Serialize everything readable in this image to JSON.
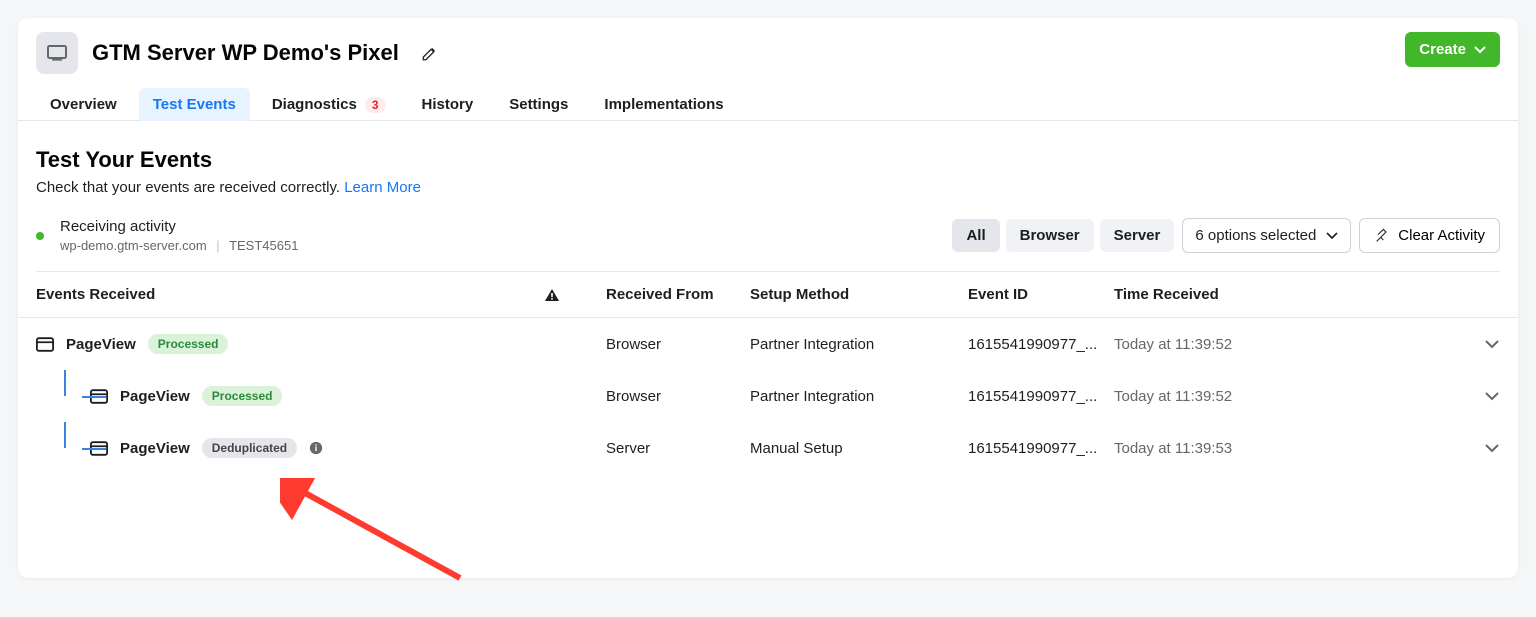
{
  "header": {
    "title": "GTM Server WP Demo's Pixel",
    "create_label": "Create"
  },
  "tabs": {
    "overview": "Overview",
    "test_events": "Test Events",
    "diagnostics": "Diagnostics",
    "diagnostics_count": "3",
    "history": "History",
    "settings": "Settings",
    "implementations": "Implementations"
  },
  "section": {
    "title": "Test Your Events",
    "subtitle": "Check that your events are received correctly. ",
    "learn_more": "Learn More"
  },
  "activity": {
    "label": "Receiving activity",
    "domain": "wp-demo.gtm-server.com",
    "test_id": "TEST45651"
  },
  "filters": {
    "all": "All",
    "browser": "Browser",
    "server": "Server",
    "options": "6 options selected",
    "clear": "Clear Activity"
  },
  "columns": {
    "events": "Events Received",
    "from": "Received From",
    "setup": "Setup Method",
    "event_id": "Event ID",
    "time": "Time Received"
  },
  "rows": [
    {
      "name": "PageView",
      "status": "Processed",
      "status_kind": "green",
      "from": "Browser",
      "setup": "Partner Integration",
      "event_id": "1615541990977_...",
      "time": "Today at 11:39:52",
      "indent": 0
    },
    {
      "name": "PageView",
      "status": "Processed",
      "status_kind": "green",
      "from": "Browser",
      "setup": "Partner Integration",
      "event_id": "1615541990977_...",
      "time": "Today at 11:39:52",
      "indent": 1
    },
    {
      "name": "PageView",
      "status": "Deduplicated",
      "status_kind": "gray",
      "from": "Server",
      "setup": "Manual Setup",
      "event_id": "1615541990977_...",
      "time": "Today at 11:39:53",
      "indent": 1,
      "info": true
    }
  ]
}
